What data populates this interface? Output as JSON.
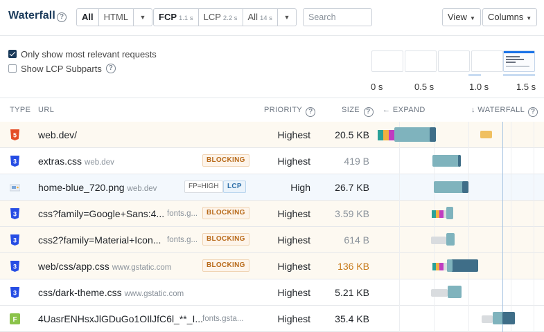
{
  "toolbar": {
    "title": "Waterfall",
    "type_filter": {
      "all": "All",
      "html": "HTML"
    },
    "timing_filter": [
      {
        "label": "FCP",
        "time": "1.1 s"
      },
      {
        "label": "LCP",
        "time": "2.2 s"
      },
      {
        "label": "All",
        "time": "14 s"
      }
    ],
    "search_placeholder": "Search",
    "view_label": "View",
    "columns_label": "Columns"
  },
  "options": {
    "relevant_label": "Only show most relevant requests",
    "relevant_checked": true,
    "lcp_subparts_label": "Show LCP Subparts",
    "lcp_subparts_checked": false
  },
  "filmstrip": {
    "time_labels": [
      "0 s",
      "0.5 s",
      "1.0 s",
      "1.5 s"
    ]
  },
  "headers": {
    "type": "TYPE",
    "url": "URL",
    "priority": "PRIORITY",
    "size": "SIZE",
    "expand": "← EXPAND",
    "waterfall": "↓ WATERFALL"
  },
  "rows": [
    {
      "type": "html",
      "url": "web.dev/",
      "domain": "",
      "badges": [],
      "priority": "Highest",
      "size": "20.5 KB",
      "size_style": "normal"
    },
    {
      "type": "css",
      "url": "extras.css",
      "domain": "web.dev",
      "badges": [
        "BLOCKING"
      ],
      "priority": "Highest",
      "size": "419 B",
      "size_style": "muted"
    },
    {
      "type": "image",
      "url": "home-blue_720.png",
      "domain": "web.dev",
      "badges": [
        "FP=HIGH",
        "LCP"
      ],
      "priority": "High",
      "size": "26.7 KB",
      "size_style": "normal"
    },
    {
      "type": "css",
      "url": "css?family=Google+Sans:4...",
      "domain": "fonts.g...",
      "badges": [
        "BLOCKING"
      ],
      "priority": "Highest",
      "size": "3.59 KB",
      "size_style": "muted"
    },
    {
      "type": "css",
      "url": "css2?family=Material+Icon...",
      "domain": "fonts.g...",
      "badges": [
        "BLOCKING"
      ],
      "priority": "Highest",
      "size": "614 B",
      "size_style": "muted"
    },
    {
      "type": "css",
      "url": "web/css/app.css",
      "domain": "www.gstatic.com",
      "badges": [
        "BLOCKING"
      ],
      "priority": "Highest",
      "size": "136 KB",
      "size_style": "big"
    },
    {
      "type": "css",
      "url": "css/dark-theme.css",
      "domain": "www.gstatic.com",
      "badges": [],
      "priority": "Highest",
      "size": "5.21 KB",
      "size_style": "normal"
    },
    {
      "type": "font",
      "url": "4UasrENHsxJlGDuGo1OIlJfC6l_**_I...",
      "domain": "fonts.gsta...",
      "badges": [],
      "priority": "Highest",
      "size": "35.4 KB",
      "size_style": "normal"
    }
  ],
  "colors": {
    "brand": "#1a3a5a",
    "html_icon": "#e44d26",
    "css_icon": "#264de4",
    "font_icon": "#8bc34a",
    "blocking": "#b86a1a",
    "bar_main": "#7fb3bd",
    "bar_dark": "#3f6e88",
    "dns": "#2aa198",
    "connect": "#f0b040",
    "ssl": "#c03cc0",
    "wait": "#d9dcdf"
  }
}
